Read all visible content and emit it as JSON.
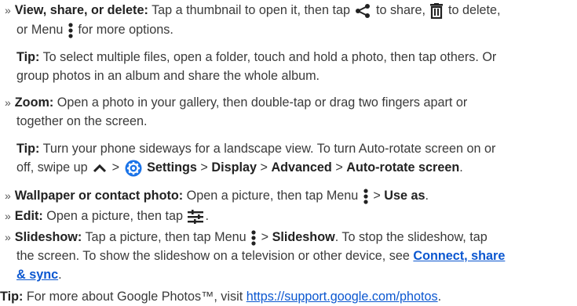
{
  "view_share_delete": {
    "bullet": "»",
    "heading": "View, share, or delete:",
    "text1": "Tap a thumbnail to open it, then tap",
    "text2": "to share,",
    "text3": "to delete,",
    "text4": "or Menu",
    "text5": "for more options."
  },
  "tip_multiple": {
    "label": "Tip:",
    "line1": "To select multiple files, open a folder, touch and hold a photo, then tap others. Or",
    "line2": "group photos in an album and share the whole album."
  },
  "zoom": {
    "bullet": "»",
    "heading": "Zoom:",
    "line1": "Open a photo in your gallery, then double-tap or drag two fingers apart or",
    "line2": "together on the screen."
  },
  "tip_rotate": {
    "label": "Tip:",
    "line1": "Turn your phone sideways for a landscape view. To turn Auto-rotate screen on or",
    "line2_pre": "off, swipe up",
    "sep": ">",
    "settings": "Settings",
    "display": "Display",
    "advanced": "Advanced",
    "autorotate": "Auto-rotate screen",
    "end": "."
  },
  "wallpaper": {
    "bullet": "»",
    "heading": "Wallpaper or contact photo:",
    "text": "Open a picture, then tap Menu",
    "sep": ">",
    "use_as": "Use as",
    "end": "."
  },
  "edit": {
    "bullet": "»",
    "heading": "Edit:",
    "text": "Open a picture, then tap",
    "end": "."
  },
  "slideshow": {
    "bullet": "»",
    "heading": "Slideshow:",
    "text1": "Tap a picture, then tap Menu",
    "sep": ">",
    "slideshow": "Slideshow",
    "text2": ". To stop the slideshow, tap",
    "line2_text": "the screen. To show the slideshow on a television or other device, see",
    "link_part1": "Connect, share",
    "link_part2": "& sync",
    "end": "."
  },
  "footer_tip": {
    "label": "Tip:",
    "text": "For more about Google Photos™, visit",
    "url": "https://support.google.com/photos",
    "end": "."
  },
  "icons": [
    "share-icon",
    "trash-icon",
    "menu-dots-icon",
    "chevron-up-icon",
    "settings-gear-icon",
    "edit-sliders-icon"
  ],
  "colors": {
    "text": "#3a3a3a",
    "link": "#0b57d0",
    "settings_icon": "#1a73e8"
  }
}
